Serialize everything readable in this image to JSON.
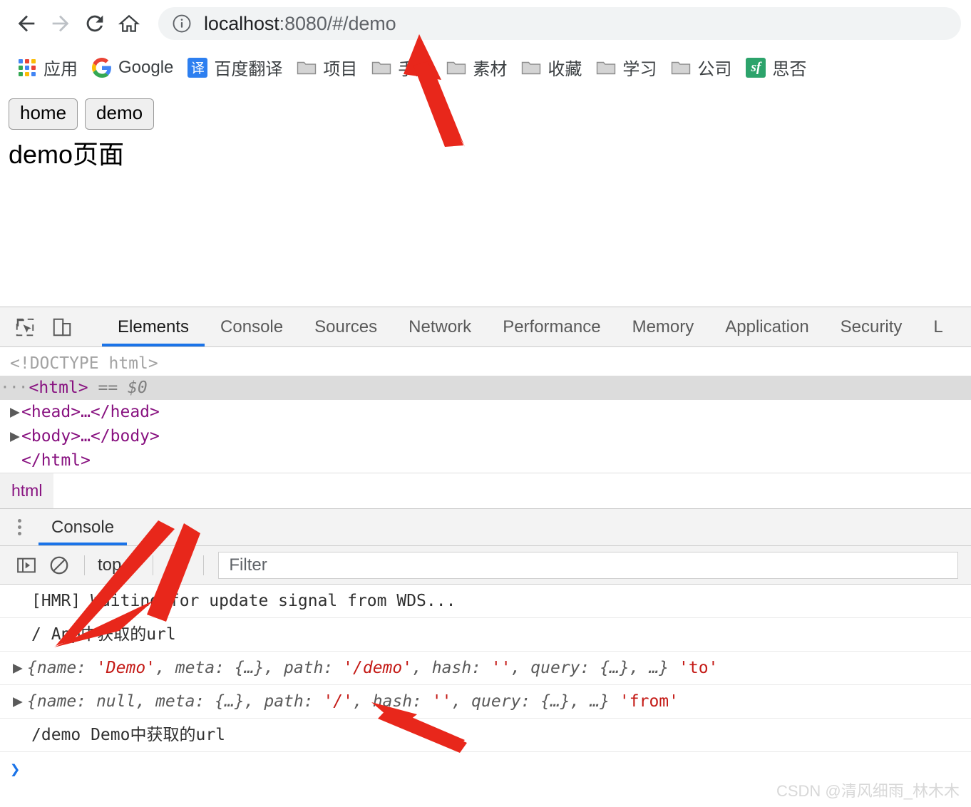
{
  "browser": {
    "nav": {
      "back_label": "Back",
      "forward_label": "Forward",
      "reload_label": "Reload",
      "home_label": "Home"
    },
    "omnibox": {
      "info_icon": "info-circle-icon",
      "url_host": "localhost",
      "url_rest": ":8080/#/demo",
      "full_url": "localhost:8080/#/demo"
    },
    "bookmarks": [
      {
        "label": "应用",
        "icon": "apps-grid-icon"
      },
      {
        "label": "Google",
        "icon": "google-g-icon"
      },
      {
        "label": "百度翻译",
        "icon": "translate-icon",
        "icon_text": "译"
      },
      {
        "label": "项目",
        "icon": "folder-icon"
      },
      {
        "label": "手册",
        "icon": "folder-icon"
      },
      {
        "label": "素材",
        "icon": "folder-icon"
      },
      {
        "label": "收藏",
        "icon": "folder-icon"
      },
      {
        "label": "学习",
        "icon": "folder-icon"
      },
      {
        "label": "公司",
        "icon": "folder-icon"
      },
      {
        "label": "思否",
        "icon": "segmentfault-icon",
        "icon_text": "sf"
      }
    ]
  },
  "page": {
    "buttons": [
      {
        "label": "home"
      },
      {
        "label": "demo"
      }
    ],
    "heading": "demo页面"
  },
  "devtools": {
    "tool_icons": [
      {
        "name": "inspect-element-icon"
      },
      {
        "name": "device-toolbar-icon"
      }
    ],
    "tabs": [
      {
        "label": "Elements",
        "active": true
      },
      {
        "label": "Console",
        "active": false
      },
      {
        "label": "Sources",
        "active": false
      },
      {
        "label": "Network",
        "active": false
      },
      {
        "label": "Performance",
        "active": false
      },
      {
        "label": "Memory",
        "active": false
      },
      {
        "label": "Application",
        "active": false
      },
      {
        "label": "Security",
        "active": false
      },
      {
        "label": "L",
        "active": false
      }
    ],
    "dom": {
      "doctype": "<!DOCTYPE html>",
      "html_open": "<html>",
      "selected_marker": "== $0",
      "head_line": "<head>…</head>",
      "body_line": "<body>…</body>",
      "html_close": "</html>"
    },
    "breadcrumb": [
      "html"
    ],
    "drawer": {
      "tab_label": "Console",
      "kebab_name": "more-options-icon",
      "toolbar": {
        "sidebar_toggle": "console-sidebar-icon",
        "clear": "clear-console-icon",
        "context": "top",
        "eye": "live-expression-icon",
        "filter_placeholder": "Filter"
      },
      "logs": [
        {
          "type": "text",
          "text": "[HMR] Waiting for update signal from WDS..."
        },
        {
          "type": "text",
          "text": "/ App中获取的url"
        },
        {
          "type": "object",
          "prefix": "{",
          "parts": [
            {
              "t": "key",
              "v": "name: "
            },
            {
              "t": "str",
              "v": "'Demo'"
            },
            {
              "t": "key",
              "v": ", meta: {…}, path: "
            },
            {
              "t": "str",
              "v": "'/demo'"
            },
            {
              "t": "key",
              "v": ", hash: "
            },
            {
              "t": "str",
              "v": "''"
            },
            {
              "t": "key",
              "v": ", query: {…}, …}"
            }
          ],
          "suffix": "'to'"
        },
        {
          "type": "object",
          "prefix": "{",
          "parts": [
            {
              "t": "key",
              "v": "name: "
            },
            {
              "t": "nul",
              "v": "null"
            },
            {
              "t": "key",
              "v": ", meta: {…}, path: "
            },
            {
              "t": "str",
              "v": "'/'"
            },
            {
              "t": "key",
              "v": ", hash: "
            },
            {
              "t": "str",
              "v": "''"
            },
            {
              "t": "key",
              "v": ", query: {…}, …}"
            }
          ],
          "suffix": "'from'"
        },
        {
          "type": "text",
          "text": "/demo Demo中获取的url"
        }
      ],
      "prompt": "❯"
    }
  },
  "annotations": {
    "arrow_color": "#e8271b",
    "arrows": [
      {
        "name": "arrow-to-url-bar"
      },
      {
        "name": "arrow-to-console-log"
      },
      {
        "name": "arrow-to-path-value"
      }
    ]
  },
  "watermark": "CSDN @清风细雨_林木木"
}
